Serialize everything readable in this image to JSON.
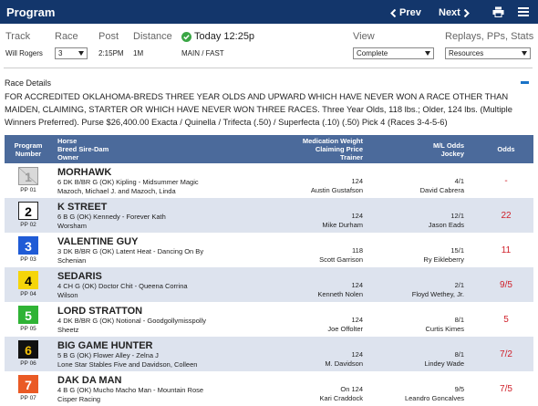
{
  "header": {
    "title": "Program",
    "prev_label": "Prev",
    "next_label": "Next"
  },
  "filters": {
    "track_label": "Track",
    "race_label": "Race",
    "post_label": "Post",
    "distance_label": "Distance",
    "today_label": "Today 12:25p",
    "view_label": "View",
    "replays_label": "Replays, PPs, Stats",
    "track_value": "Will Rogers",
    "race_value": "3",
    "post_value": "2:15PM",
    "distance_value": "1M",
    "surface_value": "MAIN / FAST",
    "view_value": "Complete",
    "replays_value": "Resources"
  },
  "race_details": {
    "title": "Race Details",
    "description": "FOR ACCREDITED OKLAHOMA-BREDS THREE YEAR OLDS AND UPWARD WHICH HAVE NEVER WON A RACE OTHER THAN MAIDEN, CLAIMING, STARTER OR WHICH HAVE NEVER WON THREE RACES. Three Year Olds, 118 lbs.; Older, 124 lbs. (Multiple Winners Preferred). Purse $26,400.00 Exacta / Quinella / Trifecta (.50) / Superfecta (.10) (.50) Pick 4 (Races 3-4-5-6)"
  },
  "table": {
    "columns": {
      "program": [
        "Program",
        "Number"
      ],
      "horse": [
        "Horse",
        "Breed Sire-Dam",
        "Owner"
      ],
      "medication": [
        "Medication Weight",
        "Claiming Price",
        "Trainer"
      ],
      "ml": [
        "M/L Odds",
        "Jockey"
      ],
      "odds": "Odds"
    },
    "rows": [
      {
        "num": "1",
        "pp": "PP 01",
        "bg": "#d9d9d9",
        "fg": "#9a9a9a",
        "scratched": true,
        "horse": "MORHAWK",
        "breed": "6 DK B/BR G (OK) Kipling - Midsummer Magic",
        "owner": "Mazoch, Michael J. and Mazoch, Linda",
        "weight": "124",
        "trainer": "Austin Gustafson",
        "ml": "4/1",
        "jockey": "David Cabrera",
        "odds": "-"
      },
      {
        "num": "2",
        "pp": "PP 02",
        "bg": "#ffffff",
        "fg": "#000000",
        "horse": "K STREET",
        "breed": "6 B G (OK) Kennedy - Forever Kath",
        "owner": "Worsham",
        "weight": "124",
        "trainer": "Mike Durham",
        "ml": "12/1",
        "jockey": "Jason Eads",
        "odds": "22"
      },
      {
        "num": "3",
        "pp": "PP 03",
        "bg": "#1f5bd6",
        "fg": "#ffffff",
        "horse": "VALENTINE GUY",
        "breed": "3 DK B/BR G (OK) Latent Heat - Dancing On By",
        "owner": "Schenian",
        "weight": "118",
        "trainer": "Scott Garrison",
        "ml": "15/1",
        "jockey": "Ry Eikleberry",
        "odds": "11"
      },
      {
        "num": "4",
        "pp": "PP 04",
        "bg": "#f5d50a",
        "fg": "#000000",
        "horse": "SEDARIS",
        "breed": "4 CH G (OK) Doctor Chit - Queena Corrina",
        "owner": "Wilson",
        "weight": "124",
        "trainer": "Kenneth Nolen",
        "ml": "2/1",
        "jockey": "Floyd Wethey, Jr.",
        "odds": "9/5"
      },
      {
        "num": "5",
        "pp": "PP 05",
        "bg": "#2fb335",
        "fg": "#ffffff",
        "horse": "LORD STRATTON",
        "breed": "4 DK B/BR G (OK) Notional - Goodgollymisspolly",
        "owner": "Sheetz",
        "weight": "124",
        "trainer": "Joe Offolter",
        "ml": "8/1",
        "jockey": "Curtis Kimes",
        "odds": "5"
      },
      {
        "num": "6",
        "pp": "PP 06",
        "bg": "#111111",
        "fg": "#f5c20a",
        "horse": "BIG GAME HUNTER",
        "breed": "5 B G (OK) Flower Alley - Zelna J",
        "owner": "Lone Star Stables Five and Davidson, Colleen",
        "weight": "124",
        "trainer": "M. Davidson",
        "ml": "8/1",
        "jockey": "Lindey Wade",
        "odds": "7/2"
      },
      {
        "num": "7",
        "pp": "PP 07",
        "bg": "#ea5a25",
        "fg": "#ffffff",
        "horse": "DAK DA MAN",
        "breed": "4 B G (OK) Mucho Macho Man - Mountain Rose",
        "owner": "Cisper Racing",
        "weight": "On 124",
        "trainer": "Kari Craddock",
        "ml": "9/5",
        "jockey": "Leandro Goncalves",
        "odds": "7/5"
      }
    ]
  }
}
